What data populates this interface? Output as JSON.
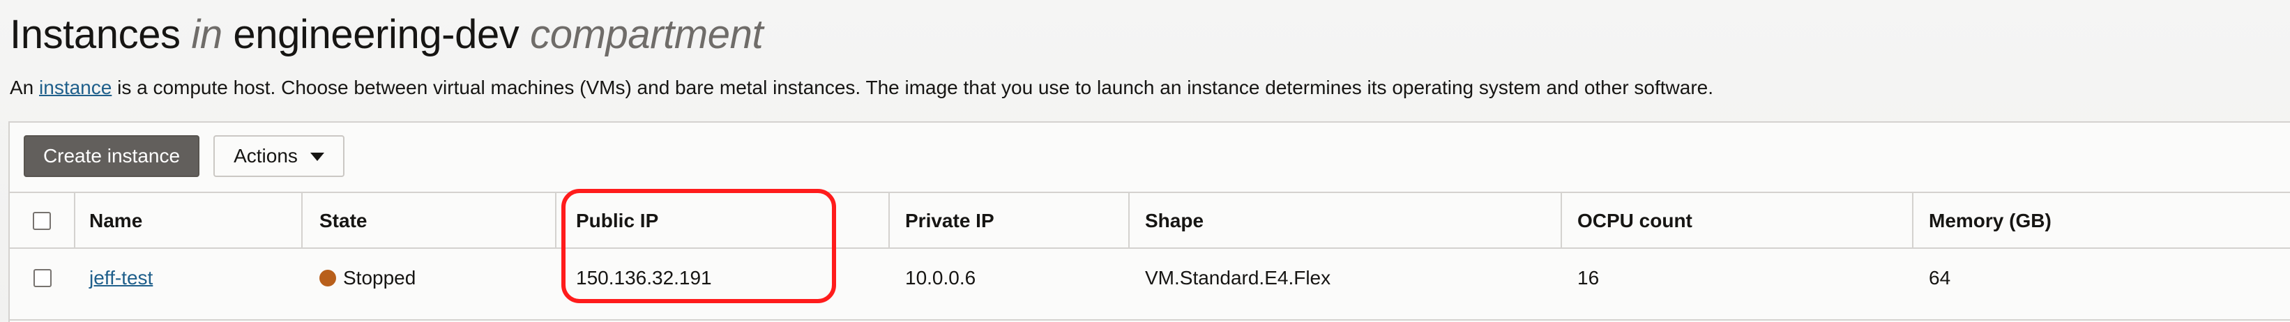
{
  "page": {
    "title_parts": [
      "Instances ",
      "in",
      " engineering-dev ",
      "compartment"
    ],
    "description_prefix": "An ",
    "description_link": "instance",
    "description_suffix": " is a compute host. Choose between virtual machines (VMs) and bare metal instances. The image that you use to launch an instance determines its operating system and other software."
  },
  "toolbar": {
    "create_label": "Create instance",
    "actions_label": "Actions",
    "actions_icon": "chevron-down-icon"
  },
  "table": {
    "columns": [
      "Name",
      "State",
      "Public IP",
      "Private IP",
      "Shape",
      "OCPU count",
      "Memory (GB)"
    ],
    "rows": [
      {
        "name": "jeff-test",
        "state": "Stopped",
        "public_ip": "150.136.32.191",
        "private_ip": "10.0.0.6",
        "shape": "VM.Standard.E4.Flex",
        "ocpu_count": "16",
        "memory_gb": "64"
      }
    ]
  },
  "colors": {
    "state_stopped": "#b85f1b",
    "highlight": "#ff1c1c",
    "link": "#1f5f8b"
  }
}
